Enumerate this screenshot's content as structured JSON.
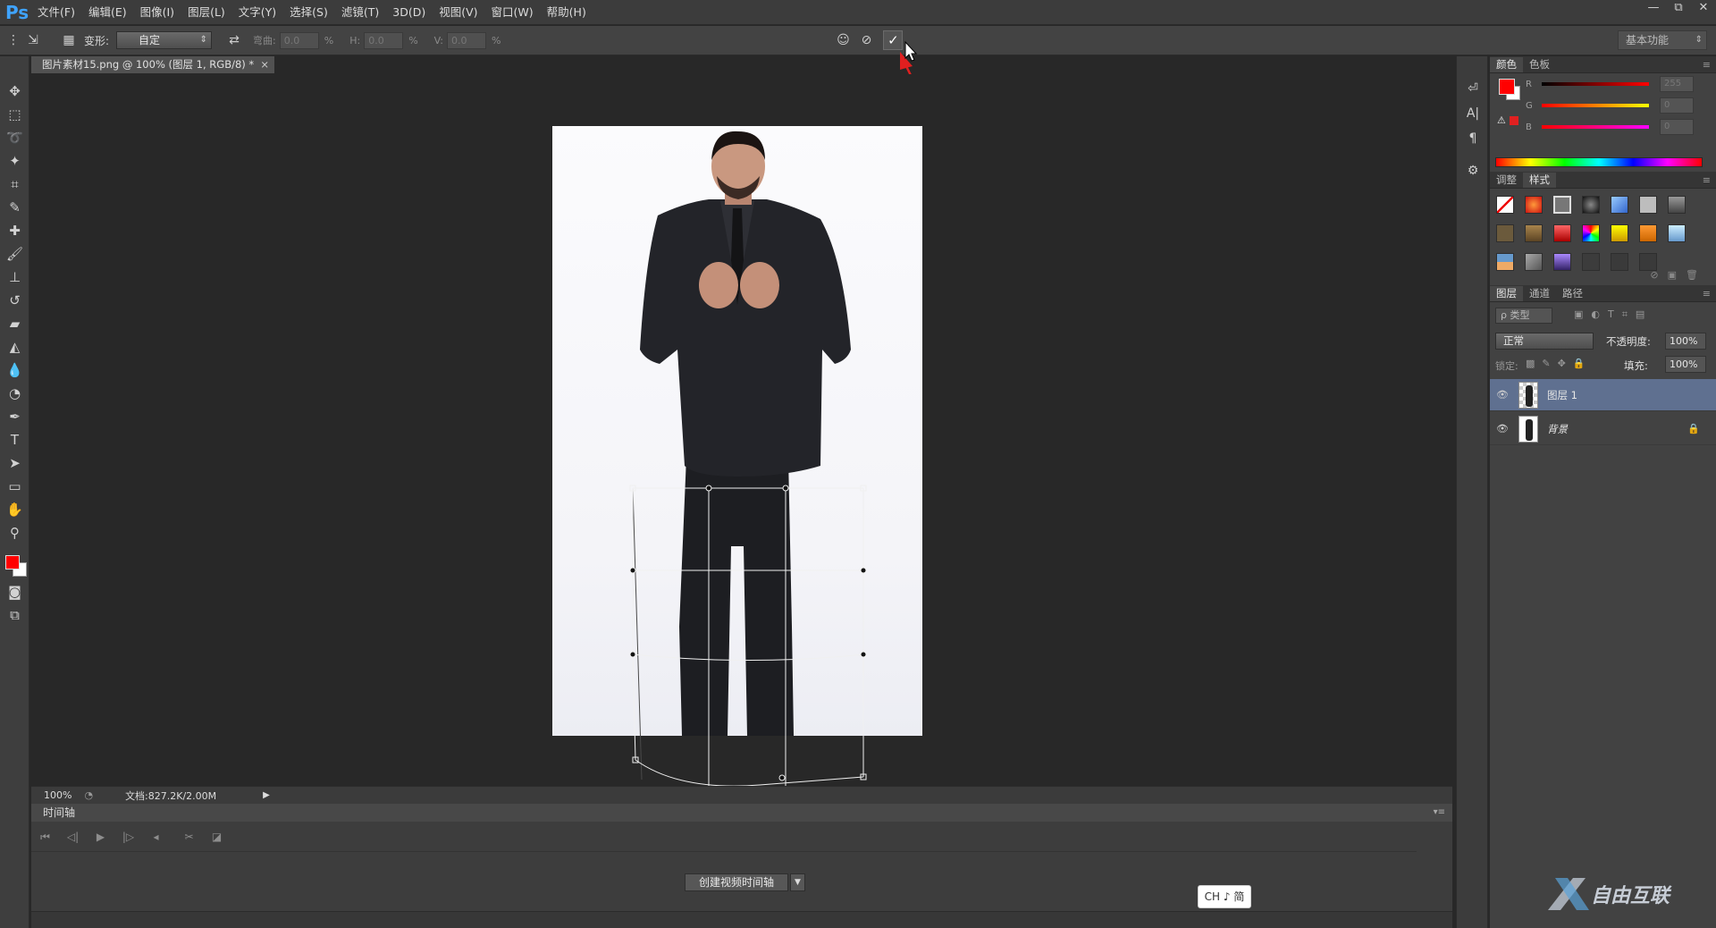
{
  "app": {
    "logo": "Ps",
    "menu": [
      "文件(F)",
      "编辑(E)",
      "图像(I)",
      "图层(L)",
      "文字(Y)",
      "选择(S)",
      "滤镜(T)",
      "3D(D)",
      "视图(V)",
      "窗口(W)",
      "帮助(H)"
    ],
    "window_controls": [
      "—",
      "⧉",
      "✕"
    ]
  },
  "options": {
    "warp_label": "变形:",
    "warp_value": "自定",
    "bend_label": "弯曲:",
    "bend_value": "0.0",
    "h_label": "H:",
    "h_value": "0.0",
    "v_label": "V:",
    "v_value": "0.0",
    "pct": "%",
    "workspace": "基本功能",
    "icons": [
      "puppet-warp-icon",
      "cancel-icon",
      "commit-check-icon"
    ]
  },
  "document": {
    "tab_title": "图片素材15.png @ 100% (图层 1, RGB/8) *",
    "tab_close": "×"
  },
  "statusbar": {
    "zoom": "100%",
    "doc_info": "文档:827.2K/2.00M"
  },
  "timeline": {
    "title": "时间轴",
    "create_button": "创建视频时间轴"
  },
  "ime": {
    "label": "CH ♪ 简"
  },
  "color_panel": {
    "tabs": [
      "颜色",
      "色板"
    ],
    "channels": [
      {
        "letter": "R",
        "value": "255"
      },
      {
        "letter": "G",
        "value": "0"
      },
      {
        "letter": "B",
        "value": "0"
      }
    ],
    "foreground": "#ff0000",
    "background": "#ffffff"
  },
  "styles_panel": {
    "tabs": [
      "调整",
      "样式"
    ]
  },
  "layers_panel": {
    "tabs": [
      "图层",
      "通道",
      "路径"
    ],
    "filter_label": "ρ 类型",
    "blend_mode": "正常",
    "opacity_label": "不透明度:",
    "opacity_value": "100%",
    "lock_label": "锁定:",
    "fill_label": "填充:",
    "fill_value": "100%",
    "layers": [
      {
        "name": "图层 1",
        "selected": true
      },
      {
        "name": "背景",
        "selected": false,
        "locked": true
      }
    ]
  },
  "watermark": {
    "text": "自由互联"
  }
}
